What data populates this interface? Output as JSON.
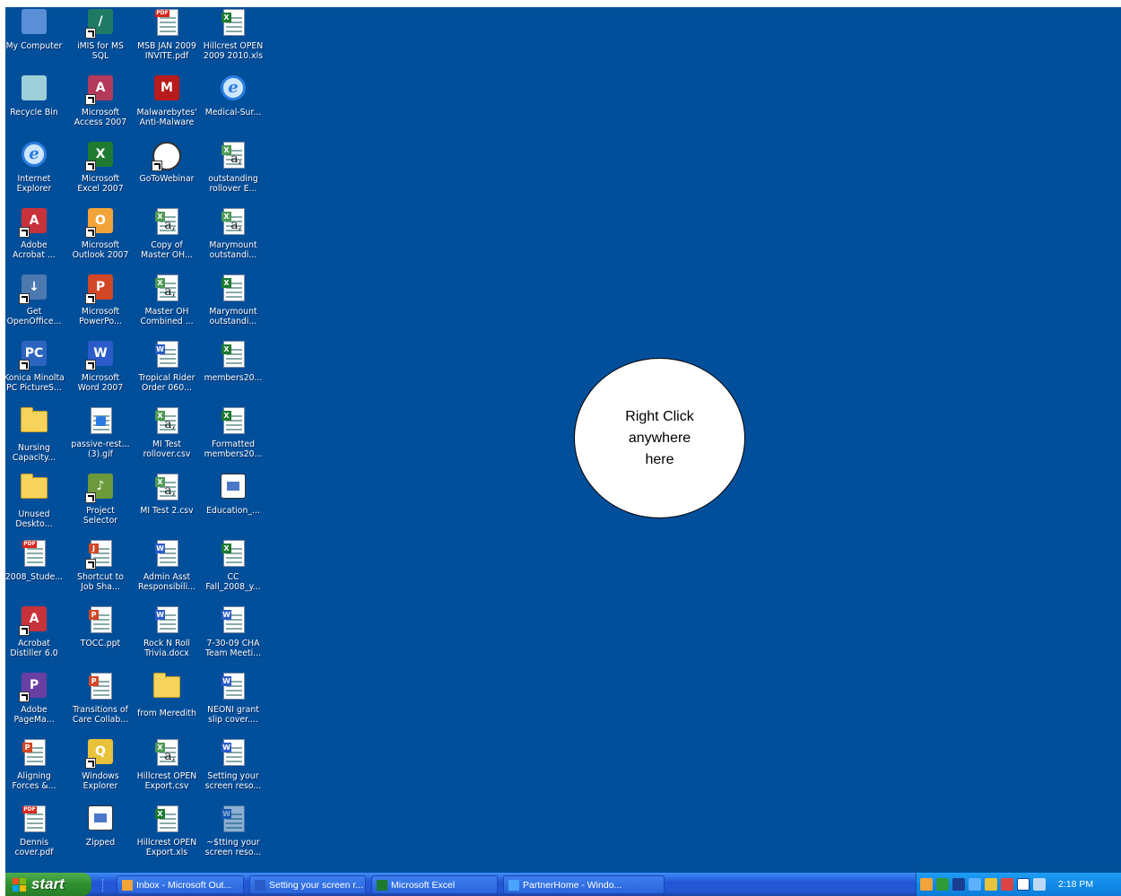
{
  "desktop": {
    "background_color": "#014f9b",
    "columns": [
      [
        {
          "label": "My Computer",
          "icon": "my-computer-icon"
        },
        {
          "label": "Recycle Bin",
          "icon": "recycle-bin-icon"
        },
        {
          "label": "Internet\nExplorer",
          "icon": "internet-explorer-icon"
        },
        {
          "label": "Adobe\nAcrobat ...",
          "icon": "adobe-acrobat-icon"
        },
        {
          "label": "Get\nOpenOffice...",
          "icon": "openoffice-installer-icon"
        },
        {
          "label": "Konica Minolta\nPC PictureS...",
          "icon": "pc-picture-studio-icon"
        },
        {
          "label": "Nursing\nCapacity...",
          "icon": "folder-icon"
        },
        {
          "label": "Unused\nDeskto...",
          "icon": "folder-icon"
        },
        {
          "label": "2008_Stude...",
          "icon": "pdf-file-icon"
        },
        {
          "label": "Acrobat\nDistiller 6.0",
          "icon": "acrobat-distiller-icon"
        },
        {
          "label": "Adobe\nPageMa...",
          "icon": "pagemaker-icon"
        },
        {
          "label": "Aligning\nForces &...",
          "icon": "powerpoint-file-icon"
        },
        {
          "label": "Dennis\ncover.pdf",
          "icon": "pdf-file-icon"
        }
      ],
      [
        {
          "label": "iMIS for MS\nSQL",
          "icon": "imis-icon"
        },
        {
          "label": "Microsoft\nAccess 2007",
          "icon": "access-icon"
        },
        {
          "label": "Microsoft\nExcel 2007",
          "icon": "excel-icon"
        },
        {
          "label": "Microsoft\nOutlook 2007",
          "icon": "outlook-icon"
        },
        {
          "label": "Microsoft\nPowerPo...",
          "icon": "powerpoint-icon"
        },
        {
          "label": "Microsoft\nWord 2007",
          "icon": "word-icon"
        },
        {
          "label": "passive-rest...\n(3).gif",
          "icon": "gif-file-icon"
        },
        {
          "label": "Project\nSelector",
          "icon": "project-selector-icon"
        },
        {
          "label": "Shortcut to\nJob Sha...",
          "icon": "shortcut-document-icon"
        },
        {
          "label": "TOCC.ppt",
          "icon": "powerpoint-file-icon"
        },
        {
          "label": "Transitions of\nCare Collab...",
          "icon": "powerpoint-file-icon"
        },
        {
          "label": "Windows\nExplorer",
          "icon": "windows-explorer-icon"
        },
        {
          "label": "Zipped",
          "icon": "zipped-folder-icon"
        }
      ],
      [
        {
          "label": "MSB JAN 2009\nINVITE.pdf",
          "icon": "pdf-file-icon"
        },
        {
          "label": "Malwarebytes'\nAnti-Malware",
          "icon": "malwarebytes-icon"
        },
        {
          "label": "GoToWebinar",
          "icon": "gotowebinar-icon"
        },
        {
          "label": "Copy of\nMaster OH...",
          "icon": "csv-file-icon"
        },
        {
          "label": "Master OH\nCombined ...",
          "icon": "csv-file-icon"
        },
        {
          "label": "Tropical Rider\nOrder 060...",
          "icon": "word-file-icon"
        },
        {
          "label": "MI Test\nrollover.csv",
          "icon": "csv-file-icon"
        },
        {
          "label": "MI Test 2.csv",
          "icon": "csv-file-icon"
        },
        {
          "label": "Admin Asst\nResponsibili...",
          "icon": "word-file-icon"
        },
        {
          "label": "Rock N Roll\nTrivia.docx",
          "icon": "word-file-icon"
        },
        {
          "label": "from Meredith",
          "icon": "folder-icon"
        },
        {
          "label": "Hillcrest OPEN\nExport.csv",
          "icon": "csv-file-icon"
        },
        {
          "label": "Hillcrest OPEN\nExport.xls",
          "icon": "excel-file-icon"
        }
      ],
      [
        {
          "label": "Hillcrest OPEN\n2009 2010.xls",
          "icon": "excel-file-icon"
        },
        {
          "label": "Medical-Sur...",
          "icon": "internet-shortcut-icon"
        },
        {
          "label": "outstanding\nrollover E...",
          "icon": "csv-file-icon"
        },
        {
          "label": "Marymount\noutstandi...",
          "icon": "csv-file-icon"
        },
        {
          "label": "Marymount\noutstandi...",
          "icon": "excel-file-icon"
        },
        {
          "label": "members20...",
          "icon": "excel-file-icon"
        },
        {
          "label": "Formatted\nmembers20...",
          "icon": "excel-file-icon"
        },
        {
          "label": "Education_...",
          "icon": "zipped-folder-icon"
        },
        {
          "label": "CC\nFall_2008_y...",
          "icon": "excel-file-icon"
        },
        {
          "label": "7-30-09 CHA\nTeam Meeti...",
          "icon": "word-file-icon"
        },
        {
          "label": "NEONI grant\nslip cover....",
          "icon": "word-file-icon"
        },
        {
          "label": "Setting your\nscreen reso...",
          "icon": "word-file-icon"
        },
        {
          "label": "~$tting your\nscreen reso...",
          "icon": "word-temp-file-icon"
        }
      ]
    ]
  },
  "callout": {
    "text": "Right Click\nanywhere\nhere"
  },
  "taskbar": {
    "start_label": "start",
    "tasks": [
      {
        "label": "Inbox - Microsoft Out...",
        "icon": "outlook-icon",
        "color": "#f2a33a"
      },
      {
        "label": "Setting your screen r...",
        "icon": "word-icon",
        "color": "#2a5bc8"
      },
      {
        "label": "Microsoft Excel",
        "icon": "excel-icon",
        "color": "#1d7a30"
      },
      {
        "label": "PartnerHome - Windo...",
        "icon": "internet-explorer-icon",
        "color": "#4aa3ff"
      }
    ],
    "clock": "2:18 PM"
  }
}
